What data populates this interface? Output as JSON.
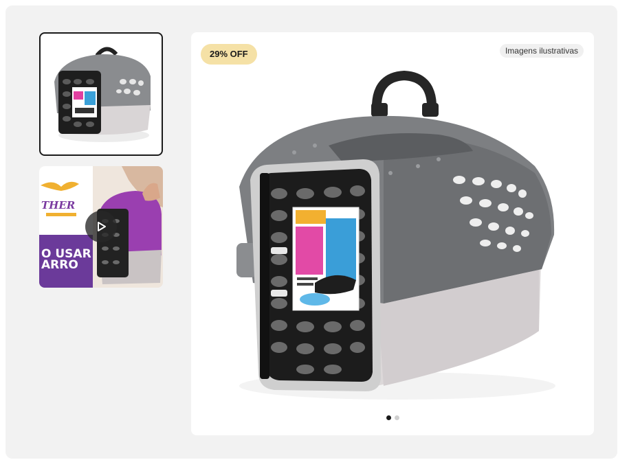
{
  "gallery": {
    "thumbnails": [
      {
        "kind": "image",
        "icon": "pet-carrier-thumbnail",
        "selected": true
      },
      {
        "kind": "video",
        "icon": "pet-carrier-video-thumbnail",
        "brand_fragment": "THER",
        "caption_lines": [
          "O USAR",
          "ARRO"
        ],
        "play_icon": "play-icon"
      }
    ],
    "main": {
      "discount_badge": "29% OFF",
      "illustrative_tag": "Imagens ilustrativas",
      "image_icon": "pet-carrier-product-image",
      "dots_total": 2,
      "active_dot": 1
    }
  },
  "colors": {
    "panel_bg": "#f2f2f2",
    "badge_bg": "#f5e1a6",
    "carrier_top": "#7d7f82",
    "carrier_base": "#ddd9da",
    "video_purple": "#6b3a9a"
  }
}
